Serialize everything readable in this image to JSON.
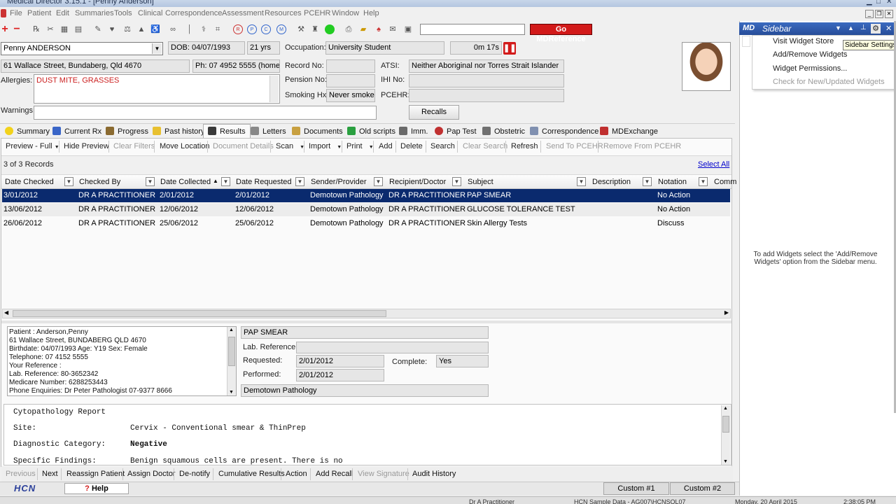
{
  "window": {
    "title": "Medical Director 3.15.1 - [Penny Anderson]"
  },
  "menu": [
    "File",
    "Patient",
    "Edit",
    "Summaries",
    "Tools",
    "Clinical",
    "Correspondence",
    "Assessment",
    "Resources",
    "PCEHR",
    "Window",
    "Help"
  ],
  "toolbar": {
    "search_value": "",
    "go_label": "Go MDReference"
  },
  "patient": {
    "name": "Penny ANDERSON",
    "dob": "DOB: 04/07/1993",
    "age": "21 yrs",
    "occupation_label": "Occupation:",
    "occupation": "University Student",
    "timer": "0m 17s",
    "address": "61 Wallace Street, Bundaberg, Qld  4670",
    "phone": "Ph: 07 4952 5555 (home)",
    "record_label": "Record No:",
    "record": "",
    "atsi_label": "ATSI:",
    "atsi": "Neither Aboriginal nor Torres Strait Islander",
    "allergies_label": "Allergies:",
    "allergies": "DUST MITE, GRASSES",
    "pension_label": "Pension No:",
    "pension": "",
    "ihi_label": "IHI No:",
    "ihi": "",
    "smoking_label": "Smoking Hx:",
    "smoking": "Never smoked",
    "pcehr_label": "PCEHR:",
    "pcehr": "",
    "warnings_label": "Warnings:",
    "warnings": "",
    "recalls_label": "Recalls"
  },
  "tabs": [
    {
      "label": "Summary",
      "color": "#f2d21b"
    },
    {
      "label": "Current Rx",
      "color": "#3a66c8"
    },
    {
      "label": "Progress",
      "color": "#8a6a30"
    },
    {
      "label": "Past history",
      "color": "#e8c030"
    },
    {
      "label": "Results",
      "color": "#3a3a3a"
    },
    {
      "label": "Letters",
      "color": "#888888"
    },
    {
      "label": "Documents",
      "color": "#c8a040"
    },
    {
      "label": "Old scripts",
      "color": "#2aa040"
    },
    {
      "label": "Imm.",
      "color": "#6a6a6a"
    },
    {
      "label": "Pap Test",
      "color": "#c03030"
    },
    {
      "label": "Obstetric",
      "color": "#707070"
    },
    {
      "label": "Correspondence",
      "color": "#8090b0"
    },
    {
      "label": "MDExchange",
      "color": "#c03030"
    }
  ],
  "actions": [
    {
      "label": "Preview - Full",
      "enabled": true
    },
    {
      "label": "Hide Preview",
      "enabled": true
    },
    {
      "label": "Clear Filters",
      "enabled": false
    },
    {
      "label": "Move Location",
      "enabled": true
    },
    {
      "label": "Document Details",
      "enabled": false
    },
    {
      "label": "Scan",
      "enabled": true
    },
    {
      "label": "Import",
      "enabled": true
    },
    {
      "label": "Print",
      "enabled": true
    },
    {
      "label": "Add",
      "enabled": true
    },
    {
      "label": "Delete",
      "enabled": true
    },
    {
      "label": "Search",
      "enabled": true
    },
    {
      "label": "Clear Search",
      "enabled": false
    },
    {
      "label": "Refresh",
      "enabled": true
    },
    {
      "label": "Send To PCEHR",
      "enabled": false
    },
    {
      "label": "Remove From PCEHR",
      "enabled": false
    }
  ],
  "grid": {
    "record_count": "3 of 3 Records",
    "select_all": "Select All",
    "columns": [
      "Date Checked",
      "Checked By",
      "Date Collected",
      "Date Requested",
      "Sender/Provider",
      "Recipient/Doctor",
      "Subject",
      "Description",
      "Notation",
      "Comm"
    ],
    "rows": [
      [
        "3/01/2012",
        "DR A PRACTITIONER",
        "2/01/2012",
        "2/01/2012",
        "Demotown Pathology",
        "DR A PRACTITIONER",
        "PAP SMEAR",
        "",
        "No Action"
      ],
      [
        "13/06/2012",
        "DR A PRACTITIONER",
        "12/06/2012",
        "12/06/2012",
        "Demotown Pathology",
        "DR A PRACTITIONER",
        "GLUCOSE TOLERANCE TEST",
        "",
        "No Action"
      ],
      [
        "26/06/2012",
        "DR A PRACTITIONER",
        "25/06/2012",
        "25/06/2012",
        "Demotown Pathology",
        "DR A PRACTITIONER",
        "Skin Allergy Tests",
        "",
        "Discuss"
      ]
    ]
  },
  "detail": {
    "patient_lines": [
      "Patient   :      Anderson,Penny",
      "61 Wallace Street, BUNDABERG QLD 4670",
      "Birthdate: 04/07/1993    Age: Y19    Sex: Female",
      "Telephone: 07 4152 5555",
      "Your Reference :",
      "Lab. Reference: 80-3652342",
      "Medicare Number:      6288253443",
      "Phone Enquiries:      Dr Peter Pathologist             07-9377 8666"
    ],
    "test_name": "PAP SMEAR",
    "lab_ref_label": "Lab. Reference:",
    "lab_ref": "",
    "requested_label": "Requested:",
    "requested": "2/01/2012",
    "complete_label": "Complete:",
    "complete": "Yes",
    "performed_label": "Performed:",
    "performed": "2/01/2012",
    "provider": "Demotown Pathology"
  },
  "report": {
    "title": "Cytopathology Report",
    "lines": [
      {
        "label": "Site:",
        "value": "Cervix - Conventional smear & ThinPrep"
      },
      {
        "label": "Diagnostic Category:",
        "value": "Negative"
      },
      {
        "label": "Specific Findings:",
        "value": "Benign squamous cells are present. There is no"
      }
    ]
  },
  "bottom_actions": [
    {
      "label": "Previous",
      "enabled": false
    },
    {
      "label": "Next",
      "enabled": true
    },
    {
      "label": "Reassign Patient",
      "enabled": true
    },
    {
      "label": "Assign Doctor",
      "enabled": true
    },
    {
      "label": "De-notify",
      "enabled": true
    },
    {
      "label": "Cumulative Results",
      "enabled": true
    },
    {
      "label": "Action",
      "enabled": true
    },
    {
      "label": "Add Recall",
      "enabled": true
    },
    {
      "label": "View Signature",
      "enabled": false
    },
    {
      "label": "Audit History",
      "enabled": true
    }
  ],
  "footer": {
    "logo": "HCN",
    "help": "Help",
    "custom1": "Custom #1",
    "custom2": "Custom #2"
  },
  "status": {
    "user": "Dr A Practitioner",
    "db": "HCN Sample Data - AG007\\HCNSQL07",
    "date": "Monday, 20 April 2015",
    "time": "2:38:05 PM"
  },
  "sidebar": {
    "title": "Sidebar",
    "menu": [
      {
        "label": "Visit Widget Store",
        "enabled": true
      },
      {
        "label": "Add/Remove Widgets",
        "enabled": true
      },
      {
        "label": "Widget Permissions...",
        "enabled": true
      },
      {
        "label": "Check for New/Updated Widgets",
        "enabled": false
      }
    ],
    "tooltip": "Sidebar Settings",
    "message": "To add Widgets select the 'Add/Remove Widgets' option from the Sidebar menu."
  },
  "colors": {
    "selected_row": "#0a2a6e",
    "link": "#0000cc",
    "allergy": "#cc2222",
    "go_button": "#d21a1a"
  }
}
